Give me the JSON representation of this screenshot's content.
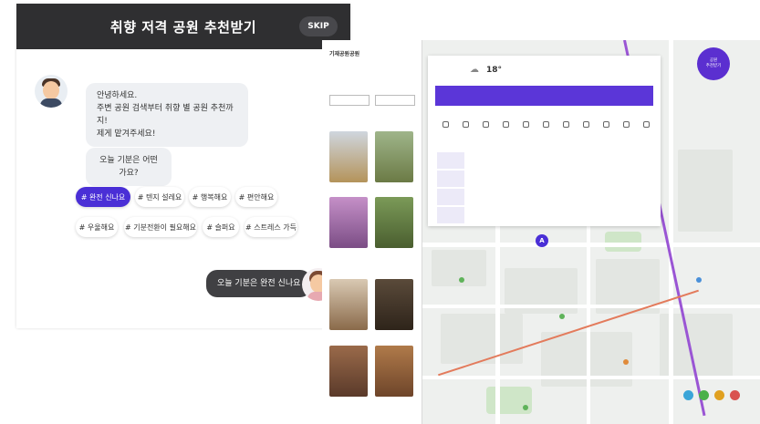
{
  "chat": {
    "title": "취향 저격 공원 추천받기",
    "skip": "SKIP",
    "bot_greeting": [
      "안녕하세요.",
      "주변 공원 검색부터 취향 별 공원 추천까지!",
      "제게 맡겨주세요!"
    ],
    "bot_question": "오늘 기분은 어떤 가요?",
    "chips": [
      "# 완전 신나요",
      "# 텐지 설레요",
      "# 행복해요",
      "# 편안해요",
      "# 우울해요",
      "# 기분전환이 필요해요",
      "# 슬퍼요",
      "# 스트레스 가득"
    ],
    "user_reply": "오늘 기분은 완전 신나요"
  },
  "map": {
    "sidebar_title": "기재공원공원",
    "panel_temp": "18°",
    "marker": "A",
    "fab": [
      "공원",
      "추천받기"
    ]
  },
  "colors": {
    "accent": "#4a2fd6",
    "header": "#2f2f31"
  }
}
